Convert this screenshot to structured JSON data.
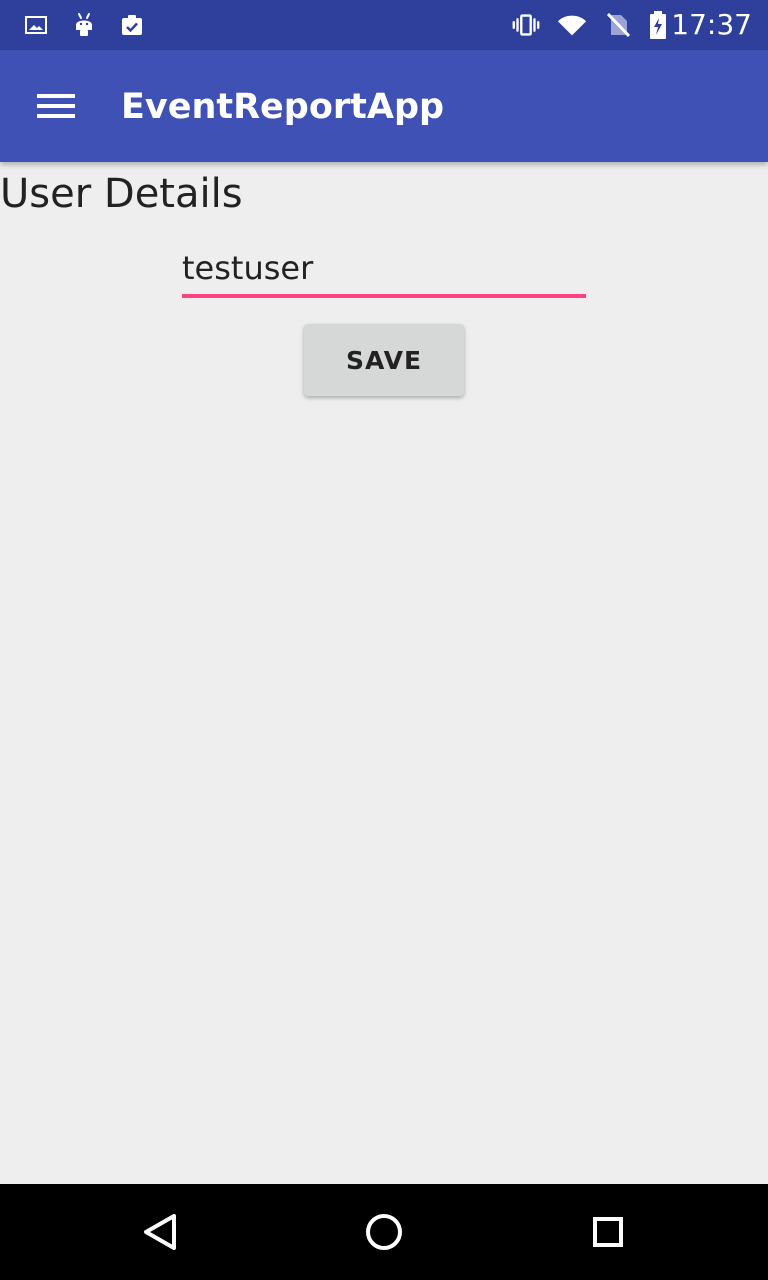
{
  "status_bar": {
    "time": "17:37",
    "left_icons": [
      "image-notification-icon",
      "android-notification-icon",
      "clipboard-check-icon"
    ],
    "right_icons": [
      "vibrate-icon",
      "wifi-icon",
      "no-sim-icon",
      "battery-charging-icon"
    ]
  },
  "app_bar": {
    "title": "EventReportApp",
    "menu_icon": "hamburger-menu-icon",
    "background": "#3f51b5"
  },
  "page": {
    "heading": "User Details"
  },
  "form": {
    "username_value": "testuser",
    "save_label": "SAVE",
    "accent_color": "#ff4081"
  },
  "navigation": {
    "back_icon": "back-triangle-icon",
    "home_icon": "home-circle-icon",
    "recents_icon": "recents-square-icon"
  }
}
